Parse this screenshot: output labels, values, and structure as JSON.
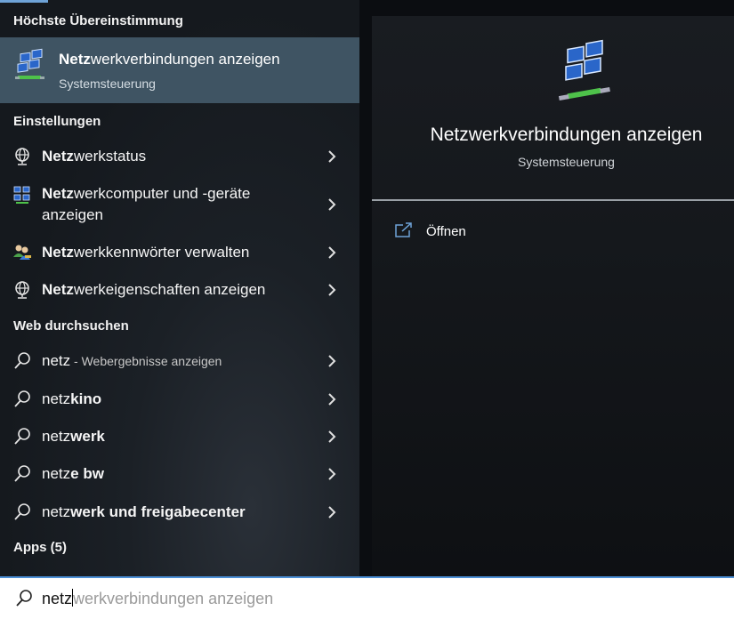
{
  "sections": {
    "best_match": "Höchste Übereinstimmung",
    "settings": "Einstellungen",
    "web": "Web durchsuchen",
    "apps": "Apps (5)"
  },
  "best_match": {
    "title_bold": "Netz",
    "title_rest": "werkverbindungen anzeigen",
    "subtitle": "Systemsteuerung",
    "icon": "network-connections-icon"
  },
  "settings_items": [
    {
      "bold": "Netz",
      "rest": "werkstatus",
      "icon": "globe-network-icon"
    },
    {
      "bold": "Netz",
      "rest": "werkcomputer und -geräte",
      "line2": "anzeigen",
      "icon": "network-computers-icon"
    },
    {
      "bold": "Netz",
      "rest": "werkkennwörter verwalten",
      "icon": "users-key-icon"
    },
    {
      "bold": "Netz",
      "rest": "werkeigenschaften anzeigen",
      "icon": "globe-network-icon"
    }
  ],
  "web_items": [
    {
      "normal": "netz",
      "bold": "",
      "hint": " - Webergebnisse anzeigen"
    },
    {
      "normal": "netz",
      "bold": "kino",
      "hint": ""
    },
    {
      "normal": "netz",
      "bold": "werk",
      "hint": ""
    },
    {
      "normal": "netz",
      "bold": "e bw",
      "hint": ""
    },
    {
      "normal": "netz",
      "bold": "werk und freigabecenter",
      "hint": ""
    }
  ],
  "preview": {
    "title": "Netzwerkverbindungen anzeigen",
    "subtitle": "Systemsteuerung",
    "open_label": "Öffnen"
  },
  "search": {
    "typed": "netz",
    "suggestion": "werkverbindungen anzeigen"
  },
  "colors": {
    "accent": "#4b8fd6",
    "highlight": "#3f5463"
  }
}
